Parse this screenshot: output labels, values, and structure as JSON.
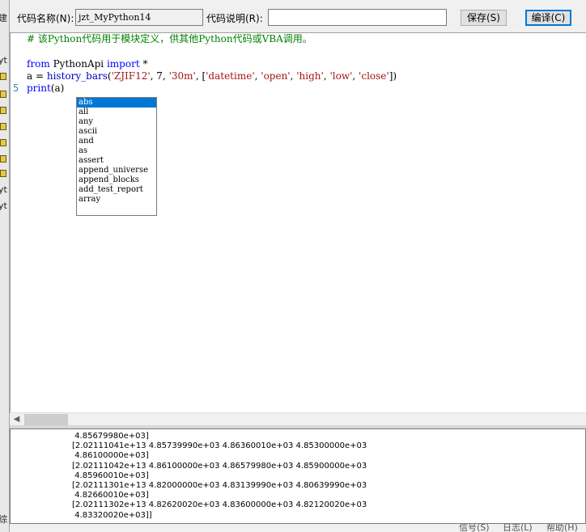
{
  "toolbar": {
    "code_name_label": "代码名称(N):",
    "code_name_value": "jzt_MyPython14",
    "code_desc_label": "代码说明(R):",
    "code_desc_value": "",
    "save_button": "保存(S)",
    "compile_button": "编译(C)"
  },
  "editor": {
    "line1_comment": "# 该Python代码用于模块定义，供其他Python代码或VBA调用。",
    "line3_kw_from": "from",
    "line3_module": " PythonApi ",
    "line3_kw_import": "import",
    "line3_rest": " *",
    "line4_prefix": "a = ",
    "line4_func": "history_bars",
    "line4_open": "(",
    "line4_arg1": "'ZJIF12'",
    "line4_mid1": ", 7, ",
    "line4_arg2": "'30m'",
    "line4_mid2": ", [",
    "line4_f1": "'datetime'",
    "line4_f2": "'open'",
    "line4_f3": "'high'",
    "line4_f4": "'low'",
    "line4_f5": "'close'",
    "line4_end": "])",
    "line5_kw": "print",
    "line5_rest": "(a)",
    "current_line_number": "5"
  },
  "autocomplete": {
    "items": [
      "abs",
      "all",
      "any",
      "ascii",
      "and",
      "as",
      "assert",
      "append_universe",
      "append_blocks",
      "add_test_report",
      "array"
    ],
    "selected_index": 0
  },
  "output": {
    "lines": [
      " 4.85679980e+03]",
      "[2.02111041e+13 4.85739990e+03 4.86360010e+03 4.85300000e+03",
      " 4.86100000e+03]",
      "[2.02111042e+13 4.86100000e+03 4.86579980e+03 4.85900000e+03",
      " 4.85960010e+03]",
      "[2.02111301e+13 4.82000000e+03 4.83139990e+03 4.80639990e+03",
      " 4.82660010e+03]",
      "[2.02111302e+13 4.82620020e+03 4.83600000e+03 4.82120020e+03",
      " 4.83320020e+03]]"
    ]
  },
  "left_strip": {
    "top_char": "建",
    "text1": "yt",
    "text2": "yt",
    "text3": "yt",
    "bottom_char": "综"
  },
  "bottom_status": {
    "text1": "信号(S)",
    "text2": "日志(L)",
    "text3": "帮助(H)"
  },
  "colors": {
    "comment": "#008000",
    "keyword": "#0000ff",
    "string": "#a31515",
    "selection": "#0078d7",
    "line_number": "#2b91af"
  },
  "icons": {
    "left_strip": "folder-icon",
    "scroll_left": "arrow-left-icon"
  }
}
